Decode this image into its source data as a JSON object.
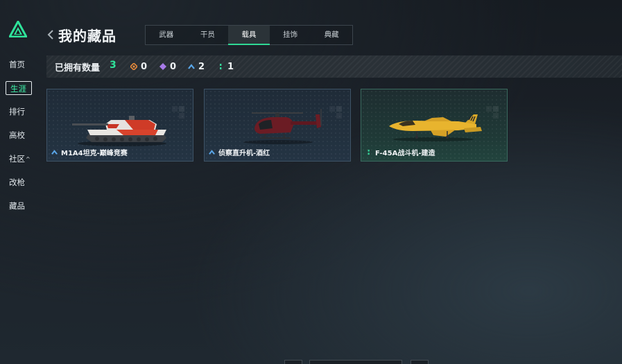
{
  "sidebar": {
    "items": [
      {
        "label": "首页",
        "active": false
      },
      {
        "label": "生涯",
        "active": true
      },
      {
        "label": "排行",
        "active": false
      },
      {
        "label": "高校",
        "active": false
      },
      {
        "label": "社区",
        "active": false,
        "caret": "^"
      },
      {
        "label": "改枪",
        "active": false
      },
      {
        "label": "藏品",
        "active": false
      }
    ]
  },
  "header": {
    "title": "我的藏品",
    "tabs": [
      {
        "label": "武器",
        "active": false
      },
      {
        "label": "干员",
        "active": false
      },
      {
        "label": "载具",
        "active": true
      },
      {
        "label": "挂饰",
        "active": false
      },
      {
        "label": "典藏",
        "active": false
      }
    ]
  },
  "stats": {
    "label": "已拥有数量",
    "total": "3",
    "items": [
      {
        "icon": "orange-diamond-icon",
        "color": "#e5893a",
        "count": "0"
      },
      {
        "icon": "purple-diamond-icon",
        "color": "#a77ae8",
        "count": "0"
      },
      {
        "icon": "blue-chevron-icon",
        "color": "#5aa7ea",
        "count": "2"
      },
      {
        "icon": "green-dots-icon",
        "color": "#35d89a",
        "count": "1"
      }
    ]
  },
  "cards": [
    {
      "name": "M1A4坦克-巅峰竞赛",
      "rarity_icon": "blue-chevron-icon",
      "rarity_color": "#5aa7ea",
      "theme": "blue"
    },
    {
      "name": "侦察直升机-酒红",
      "rarity_icon": "blue-chevron-icon",
      "rarity_color": "#5aa7ea",
      "theme": "blue"
    },
    {
      "name": "F-45A战斗机-建造",
      "rarity_icon": "green-dots-icon",
      "rarity_color": "#35d89a",
      "theme": "green"
    }
  ],
  "colors": {
    "accent": "#2fe39a",
    "background": "#1b2128"
  }
}
